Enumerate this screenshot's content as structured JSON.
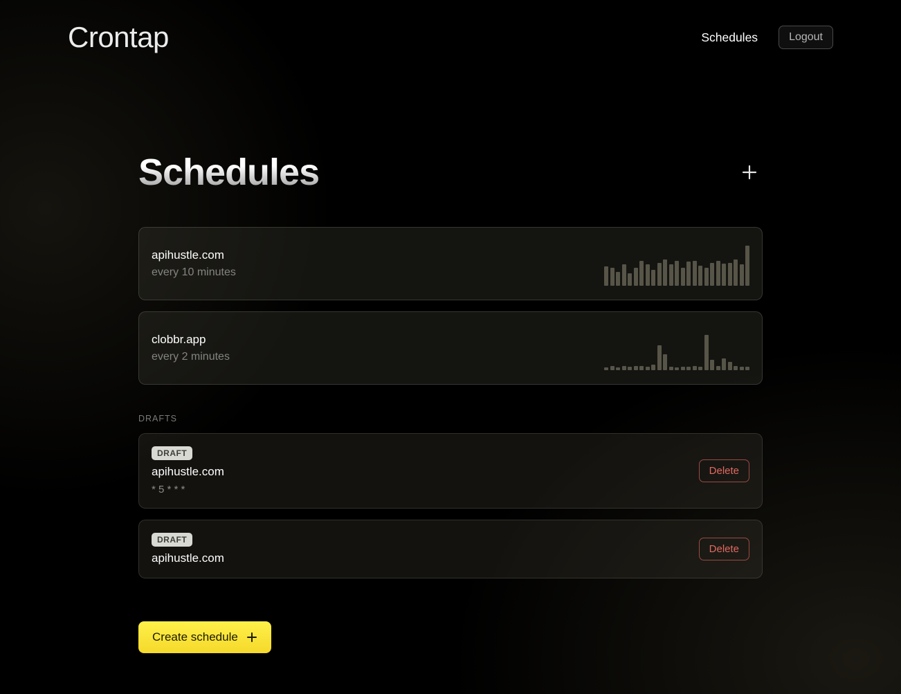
{
  "header": {
    "logo": "Crontap",
    "nav_link": "Schedules",
    "logout_label": "Logout"
  },
  "page": {
    "title": "Schedules"
  },
  "schedules": [
    {
      "name": "apihustle.com",
      "freq": "every 10 minutes",
      "bars": [
        44,
        40,
        32,
        48,
        28,
        40,
        56,
        48,
        36,
        52,
        60,
        48,
        56,
        40,
        54,
        56,
        46,
        40,
        52,
        56,
        50,
        52,
        60,
        48,
        90
      ]
    },
    {
      "name": "clobbr.app",
      "freq": "every 2 minutes",
      "bars": [
        6,
        10,
        6,
        10,
        8,
        10,
        10,
        8,
        12,
        56,
        36,
        8,
        6,
        8,
        8,
        10,
        8,
        80,
        24,
        10,
        26,
        18,
        10,
        8,
        8
      ]
    }
  ],
  "drafts_section_label": "DRAFTS",
  "draft_badge_label": "DRAFT",
  "delete_label": "Delete",
  "drafts": [
    {
      "name": "apihustle.com",
      "cron": "* 5 * * *"
    },
    {
      "name": "apihustle.com",
      "cron": ""
    }
  ],
  "create_label": "Create schedule",
  "chart_data": [
    {
      "type": "bar",
      "title": "apihustle.com activity sparkline",
      "xlabel": "",
      "ylabel": "",
      "ylim": [
        0,
        100
      ],
      "values": [
        44,
        40,
        32,
        48,
        28,
        40,
        56,
        48,
        36,
        52,
        60,
        48,
        56,
        40,
        54,
        56,
        46,
        40,
        52,
        56,
        50,
        52,
        60,
        48,
        90
      ]
    },
    {
      "type": "bar",
      "title": "clobbr.app activity sparkline",
      "xlabel": "",
      "ylabel": "",
      "ylim": [
        0,
        100
      ],
      "values": [
        6,
        10,
        6,
        10,
        8,
        10,
        10,
        8,
        12,
        56,
        36,
        8,
        6,
        8,
        8,
        10,
        8,
        80,
        24,
        10,
        26,
        18,
        10,
        8,
        8
      ]
    }
  ]
}
